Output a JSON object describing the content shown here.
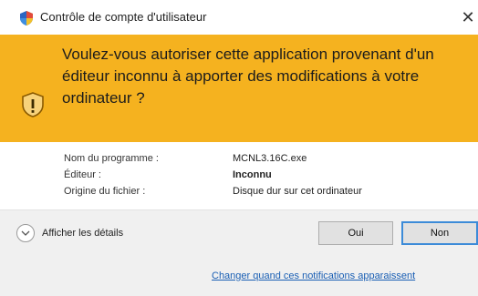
{
  "window": {
    "title": "Contrôle de compte d'utilisateur",
    "close_glyph": "✕"
  },
  "banner": {
    "message": "Voulez-vous autoriser cette application provenant d'un éditeur inconnu à apporter des modifications à votre ordinateur ?",
    "icon": "shield-warning-icon",
    "color": "#f5b21f"
  },
  "details": {
    "rows": [
      {
        "label": "Nom du programme :",
        "value": "MCNL3.16C.exe"
      },
      {
        "label": "Éditeur :",
        "value": "Inconnu"
      },
      {
        "label": "Origine du fichier :",
        "value": "Disque dur sur cet ordinateur"
      }
    ]
  },
  "footer": {
    "show_details_label": "Afficher les détails",
    "yes_label": "Oui",
    "no_label": "Non",
    "change_link": "Changer quand ces notifications apparaissent"
  }
}
